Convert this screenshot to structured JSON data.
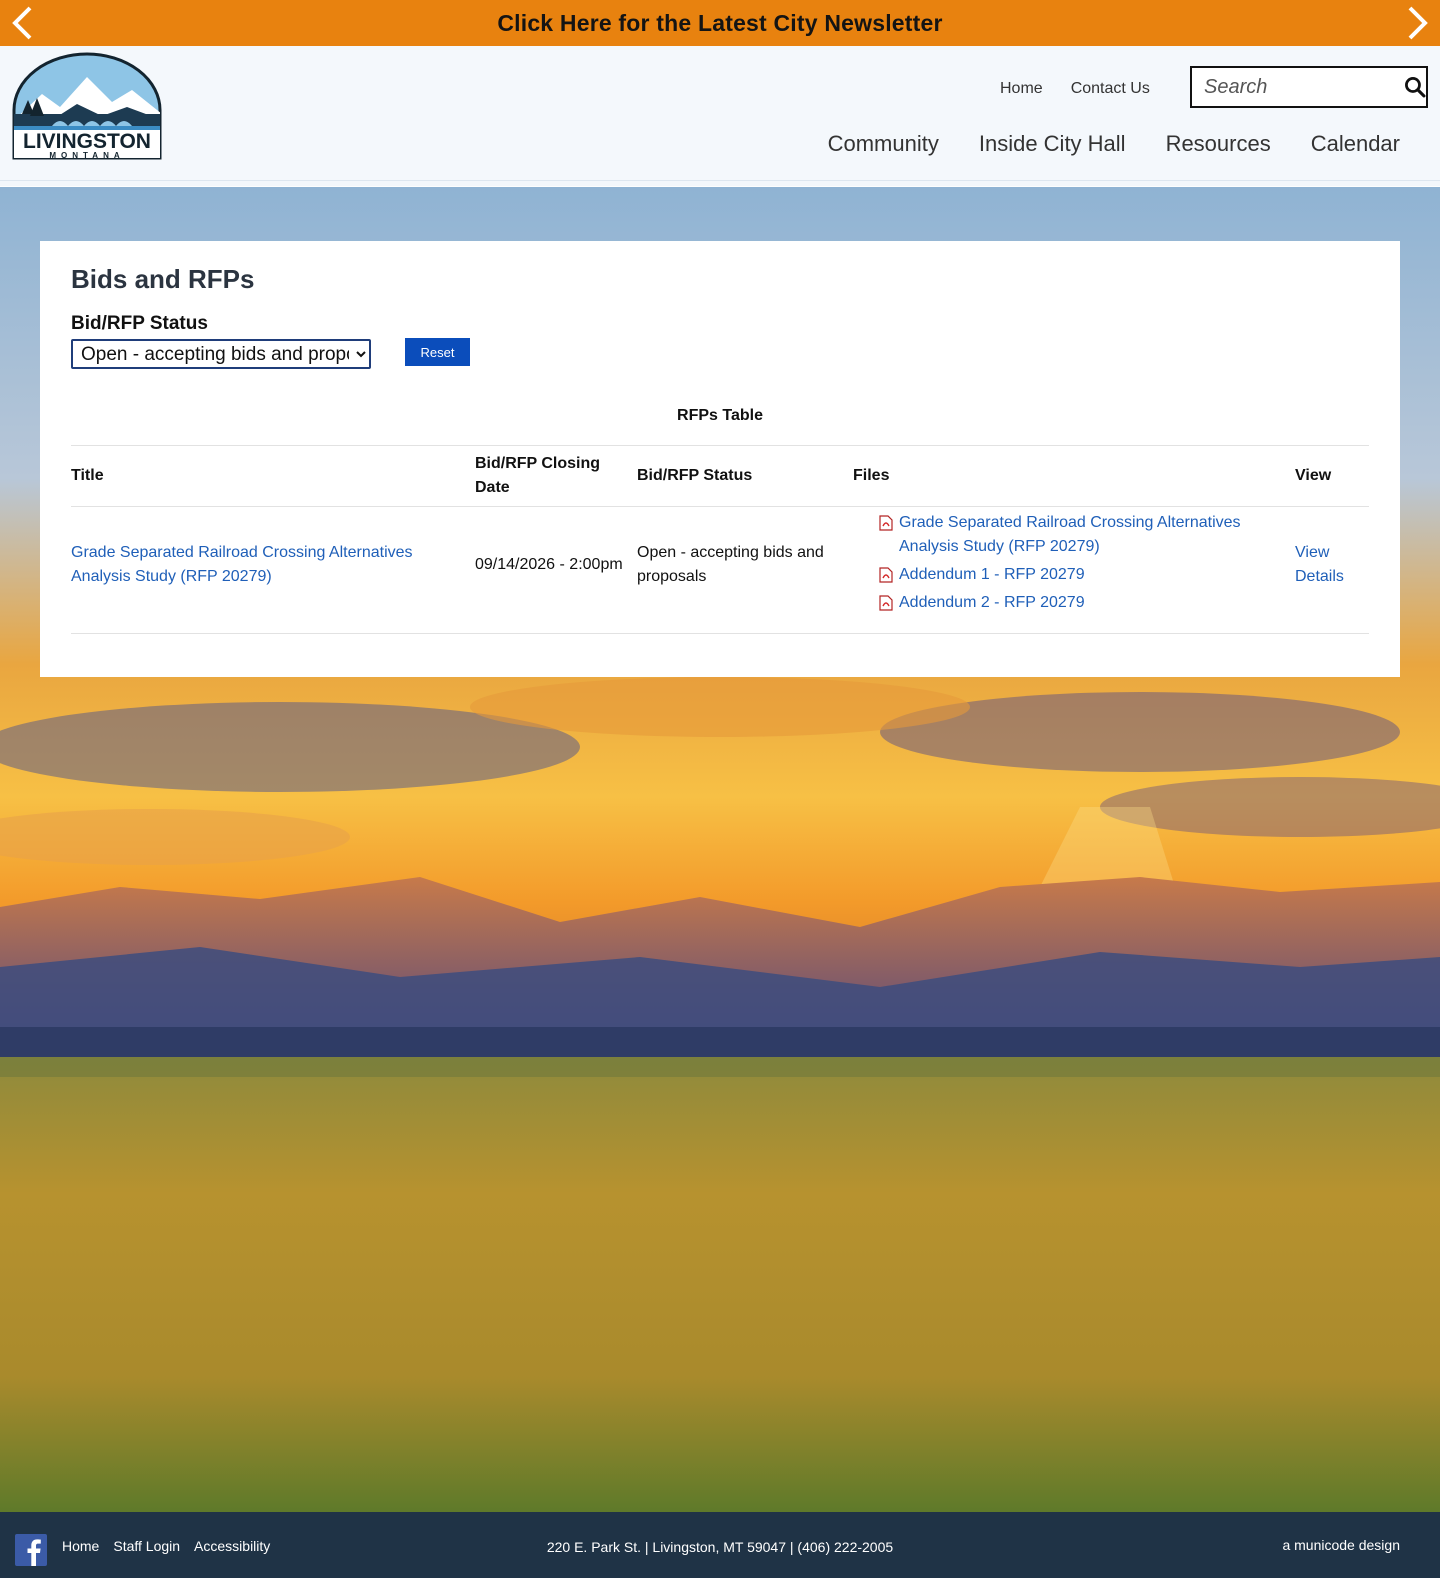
{
  "banner": {
    "text": "Click Here for the Latest City Newsletter",
    "icons": [
      "chevron-left-icon",
      "chevron-right-icon"
    ]
  },
  "logo": {
    "name": "LIVINGSTON",
    "subtitle": "MONTANA"
  },
  "utility_nav": {
    "home": "Home",
    "contact": "Contact Us"
  },
  "search": {
    "placeholder": "Search",
    "icon": "search-icon"
  },
  "main_nav": {
    "community": "Community",
    "inside_city_hall": "Inside City Hall",
    "resources": "Resources",
    "calendar": "Calendar"
  },
  "page": {
    "title": "Bids and RFPs",
    "filter_label": "Bid/RFP Status",
    "filter_selected": "Open - accepting bids and proposals",
    "reset_label": "Reset",
    "table_caption": "RFPs Table",
    "columns": {
      "title": "Title",
      "closing": "Bid/RFP Closing Date",
      "status": "Bid/RFP Status",
      "files": "Files",
      "view": "View"
    },
    "rows": [
      {
        "title": "Grade Separated Railroad Crossing Alternatives Analysis Study (RFP 20279)",
        "closing": "09/14/2026 - 2:00pm",
        "status": "Open - accepting bids and proposals",
        "files": [
          "Grade Separated Railroad Crossing Alternatives Analysis Study (RFP 20279)",
          "Addendum 1 - RFP 20279",
          "Addendum 2 - RFP 20279"
        ],
        "view": "View Details"
      }
    ]
  },
  "footer": {
    "links": {
      "home": "Home",
      "staff_login": "Staff Login",
      "accessibility": "Accessibility"
    },
    "address": "220 E. Park St. | Livingston, MT 59047 | (406) 222-2005",
    "credit": "a municode design"
  },
  "colors": {
    "banner": "#e8820f",
    "footer": "#1f3346",
    "link": "#1f5fb8",
    "button": "#0b4dbb"
  }
}
